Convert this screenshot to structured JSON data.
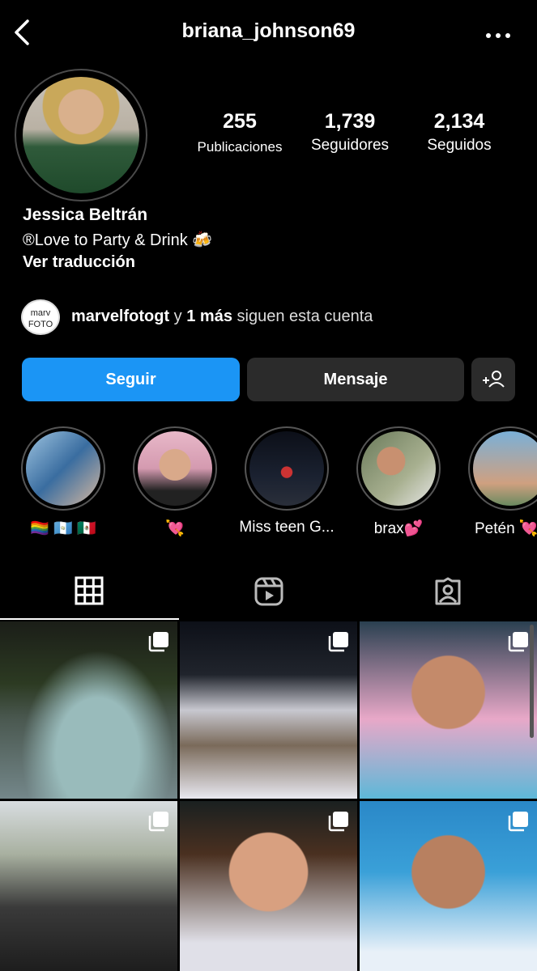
{
  "header": {
    "username": "briana_johnson69"
  },
  "profile": {
    "stats": [
      {
        "value": "255",
        "label": "Publicaciones"
      },
      {
        "value": "1,739",
        "label": "Seguidores"
      },
      {
        "value": "2,134",
        "label": "Seguidos"
      }
    ],
    "name": "Jessica Beltrán",
    "bio": "®Love to Party & Drink 🍻",
    "translate_link": "Ver traducción"
  },
  "followed_by": {
    "avatar_text": "marv FOTO",
    "user": "marvelfotogt",
    "connector": " y ",
    "more": "1 más",
    "suffix": " siguen esta cuenta"
  },
  "actions": {
    "follow": "Seguir",
    "message": "Mensaje"
  },
  "highlights": [
    {
      "caption": "🏳️‍🌈 🇬🇹 🇲🇽"
    },
    {
      "caption": "💘"
    },
    {
      "caption": "Miss teen G..."
    },
    {
      "caption": "brax💕"
    },
    {
      "caption": "Petén 💘"
    }
  ],
  "tabs": {
    "active": "posts",
    "icons": [
      "grid-icon",
      "reels-icon",
      "tagged-icon"
    ]
  },
  "posts": [
    {
      "type": "carousel"
    },
    {
      "type": "carousel"
    },
    {
      "type": "carousel"
    },
    {
      "type": "carousel"
    },
    {
      "type": "carousel"
    },
    {
      "type": "carousel"
    }
  ],
  "colors": {
    "background": "#000000",
    "primary_button": "#1b95f5",
    "secondary_button": "#2b2b2b"
  }
}
